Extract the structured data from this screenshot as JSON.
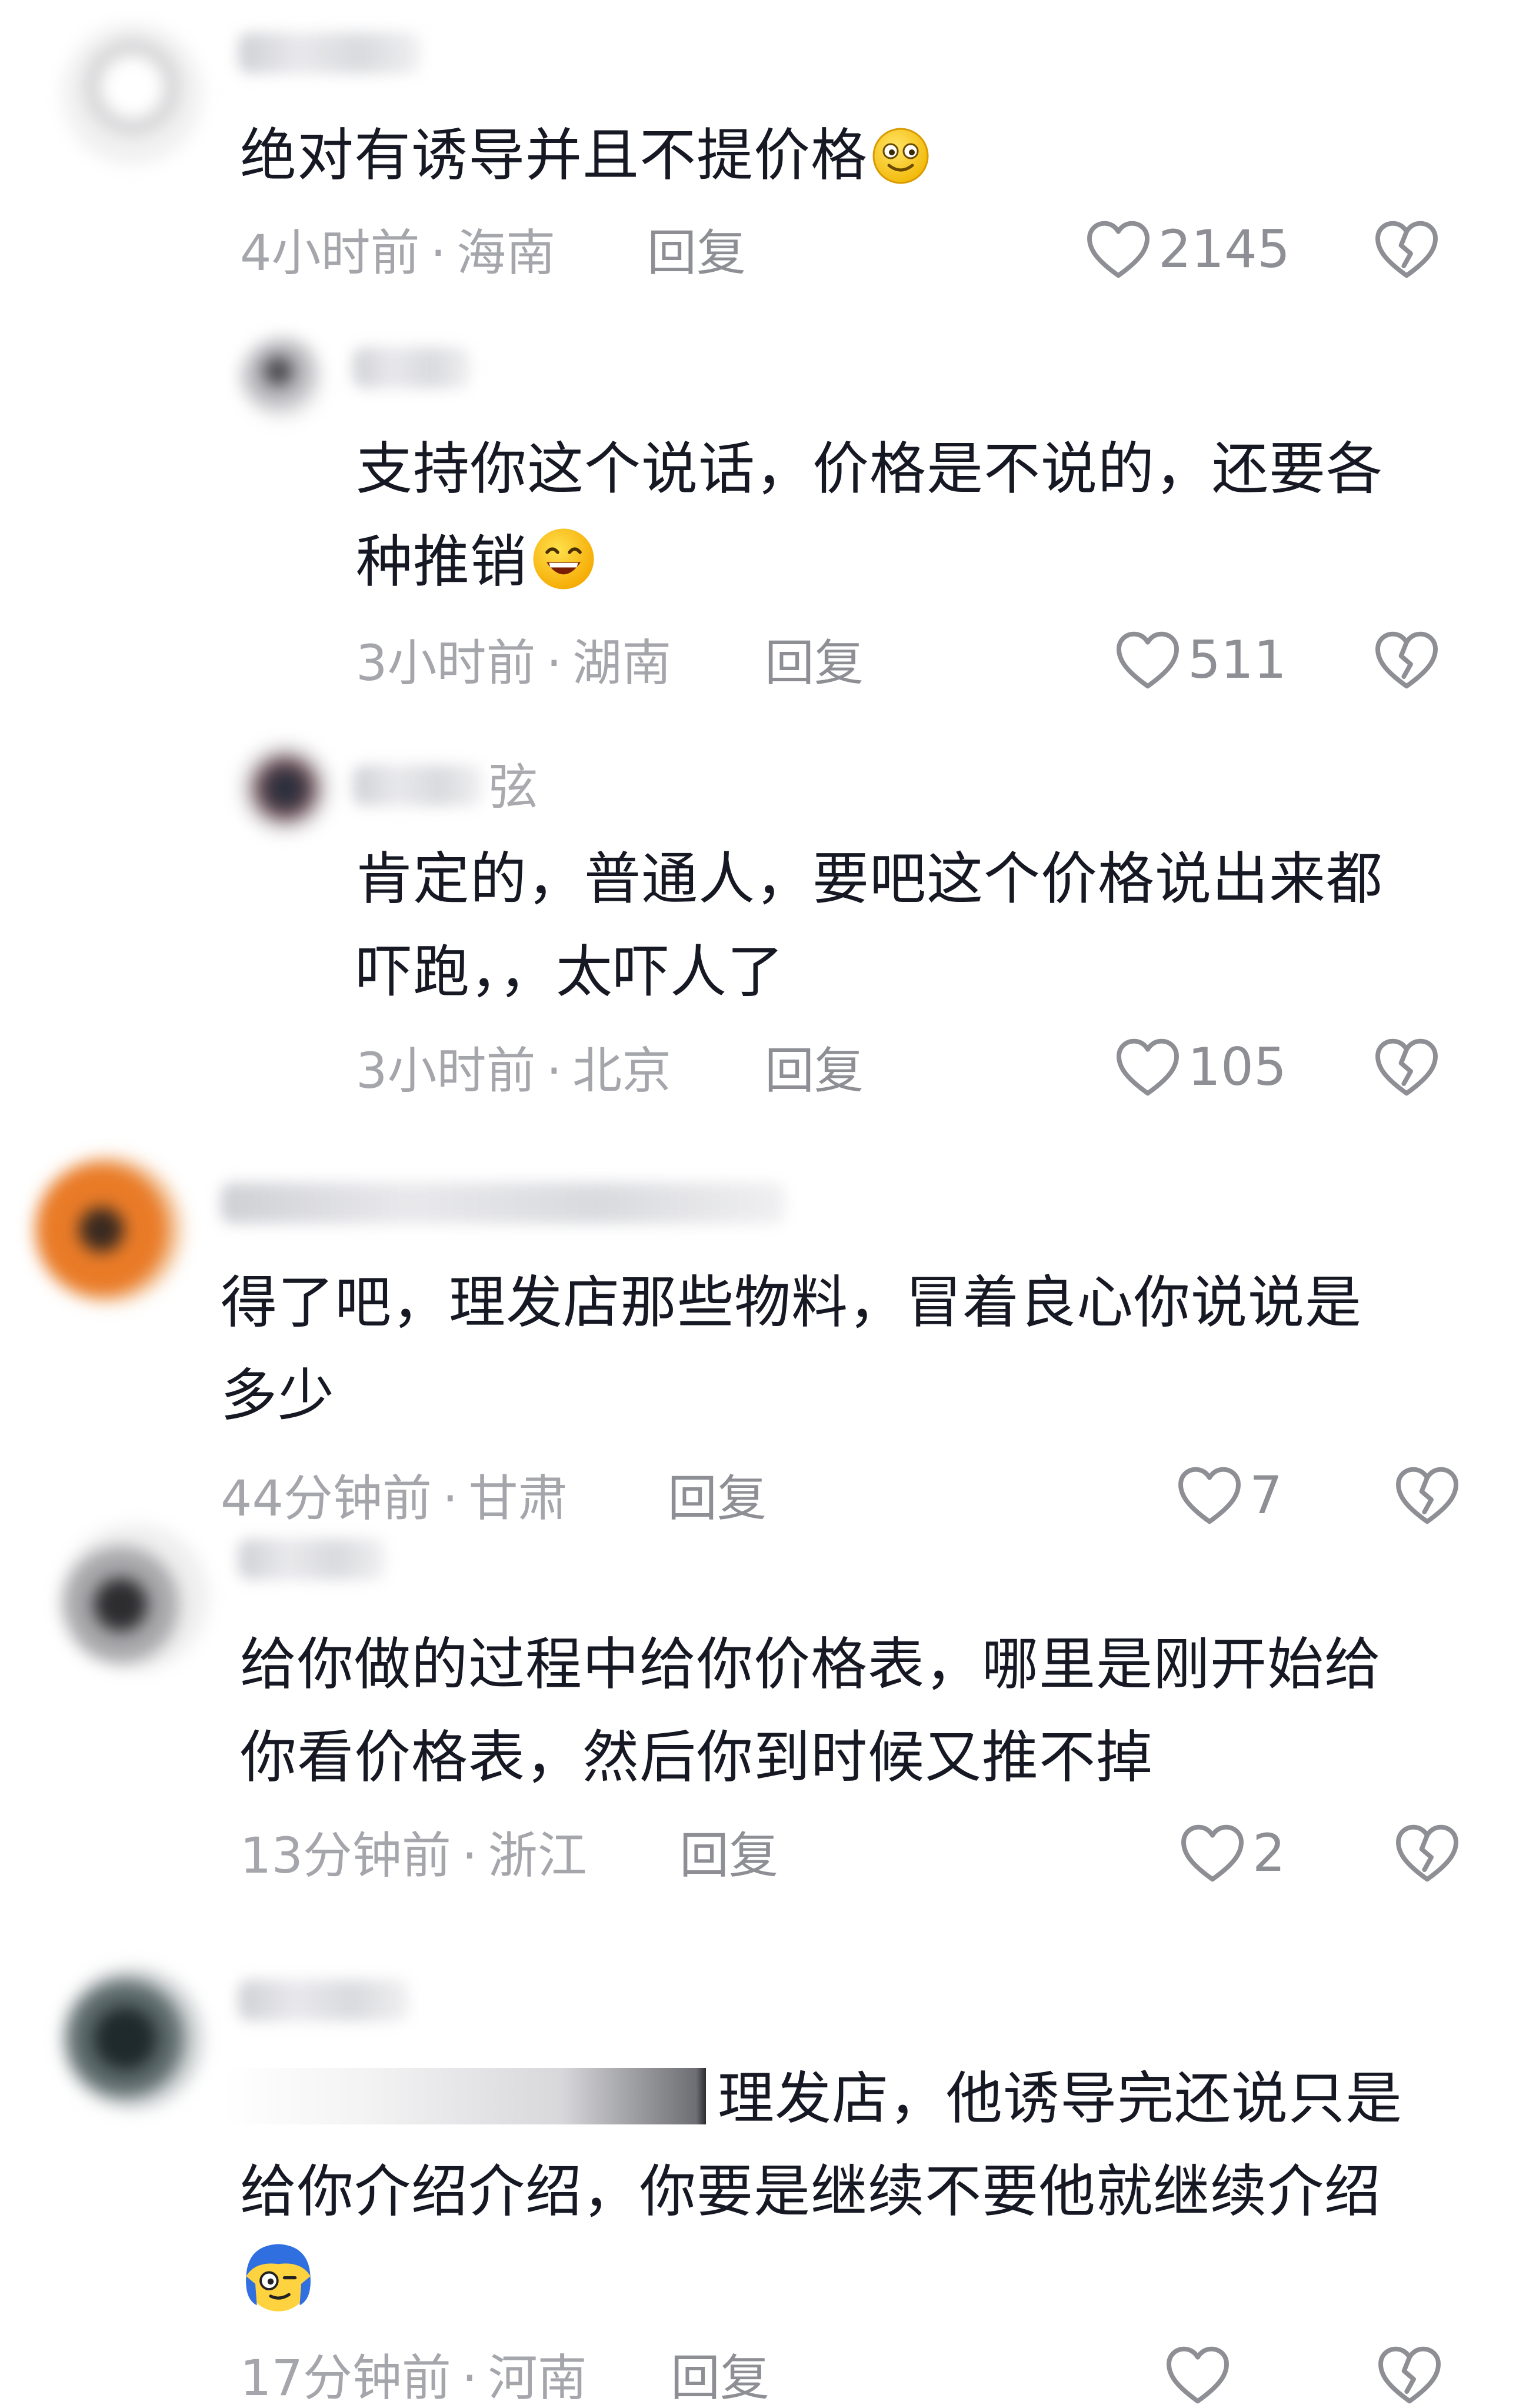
{
  "comments": [
    {
      "text": "绝对有诱导并且不提价格",
      "emoji": "smile",
      "time": "4小时前",
      "location": "海南",
      "reply_label": "回复",
      "likes": "2145"
    },
    {
      "text_line1": "支持你这个说话，价格是不说的，还要各",
      "text_line2": "种推销",
      "emoji": "grin",
      "time": "3小时前",
      "location": "湖南",
      "reply_label": "回复",
      "likes": "511"
    },
    {
      "name_tail": "弦",
      "text_line1": "肯定的，普通人，要吧这个价格说出来都",
      "text_line2": "吓跑，，太吓人了",
      "time": "3小时前",
      "location": "北京",
      "reply_label": "回复",
      "likes": "105"
    },
    {
      "text_line1": "得了吧，理发店那些物料，冒着良心你说说是",
      "text_line2": "多少",
      "time": "44分钟前",
      "location": "甘肃",
      "reply_label": "回复",
      "likes": "7"
    },
    {
      "text_line1": "给你做的过程中给你价格表，哪里是刚开始给",
      "text_line2": "你看价格表，然后你到时候又推不掉",
      "time": "13分钟前",
      "location": "浙江",
      "reply_label": "回复",
      "likes": "2"
    },
    {
      "text_line1_visible": "理发店，他诱导完还说只是",
      "text_line2": "给你介绍介绍，你要是继续不要他就继续介绍",
      "emoji": "blue-face",
      "time": "17分钟前",
      "location": "河南",
      "reply_label": "回复"
    }
  ],
  "meta_separator": "·",
  "colors": {
    "text": "#161823",
    "meta": "#a5a6ab",
    "icon": "#8e8f95"
  }
}
